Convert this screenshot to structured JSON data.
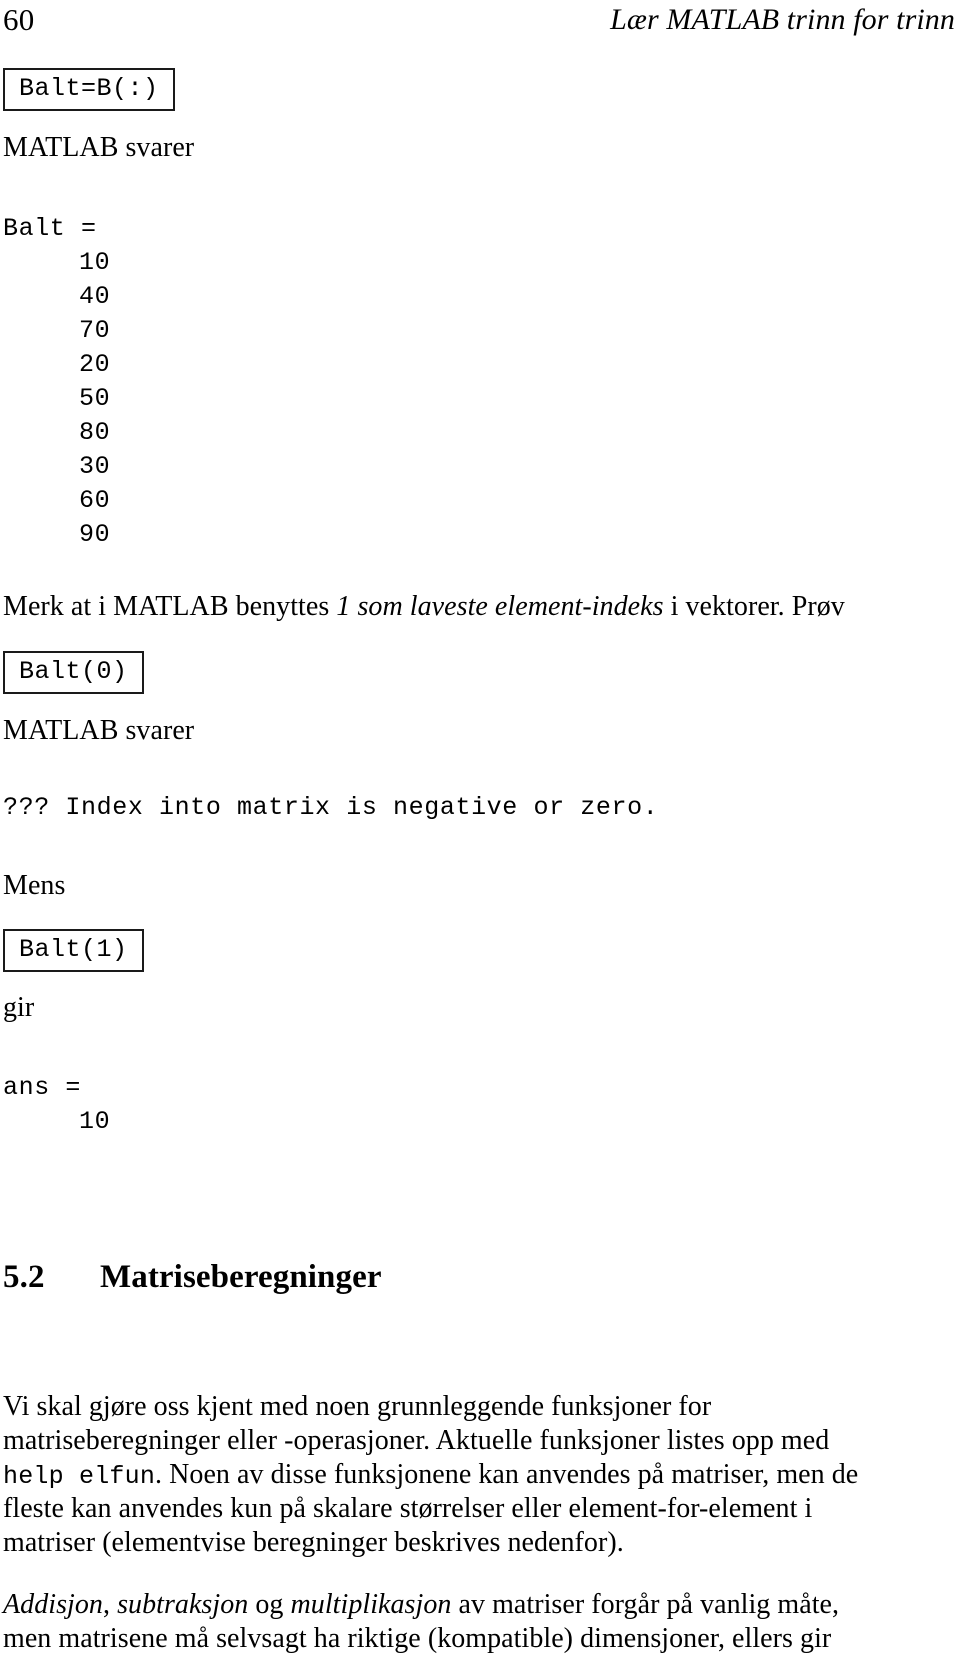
{
  "header": {
    "folio": "60",
    "title": "Lær MATLAB trinn for trinn"
  },
  "blocks": {
    "cmd_balt_colon": "Balt=B(:)",
    "svarer_1": "MATLAB svarer",
    "output_balt_label": "Balt =",
    "output_balt_values": [
      "10",
      "40",
      "70",
      "20",
      "50",
      "80",
      "30",
      "60",
      "90"
    ],
    "note_line": {
      "pre": "Merk at i MATLAB benyttes ",
      "em": "1 som laveste element-indeks",
      "post": " i vektorer. Prøv"
    },
    "cmd_balt_zero": "Balt(0)",
    "svarer_2": "MATLAB svarer",
    "error_line": "??? Index into matrix is negative or zero.",
    "mens": "Mens",
    "cmd_balt_one": "Balt(1)",
    "gir": "gir",
    "output_ans_label": "ans =",
    "output_ans_values": [
      "10"
    ]
  },
  "section": {
    "number": "5.2",
    "title": "Matriseberegninger"
  },
  "paragraphs": {
    "p1": {
      "line1": "Vi skal gjøre oss kjent med noen grunnleggende funksjoner for",
      "line2": "matriseberegninger eller -operasjoner. Aktuelle funksjoner listes opp med",
      "line3_mono": "help elfun",
      "line3_rest": ". Noen av disse funksjonene kan anvendes på matriser, men de",
      "line4": "fleste kan anvendes kun på skalare størrelser eller element-for-element i",
      "line5": "matriser (elementvise beregninger beskrives nedenfor)."
    },
    "p2": {
      "em1": "Addisjon",
      "sep1": ", ",
      "em2": "subtraksjon",
      "sep2": " og ",
      "em3": "multiplikasjon",
      "rest1": " av matriser forgår på vanlig måte,",
      "line2": "men matrisene må selvsagt ha riktige (kompatible) dimensjoner, ellers gir"
    }
  }
}
